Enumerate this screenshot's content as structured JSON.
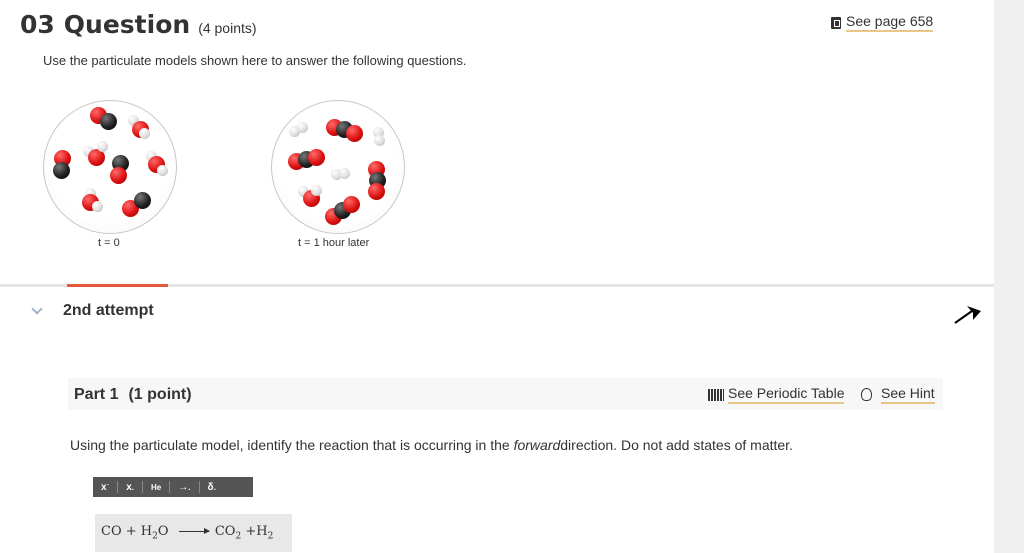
{
  "question": {
    "number": "03",
    "word": "Question",
    "points": "(4 points)",
    "see_page": "See page 658",
    "instructions": "Use the particulate models shown here to answer the following questions."
  },
  "models": {
    "left_caption": "t = 0",
    "right_caption": "t = 1 hour later"
  },
  "attempt": {
    "label": "2nd attempt"
  },
  "part": {
    "title": "Part 1",
    "points": "(1 point)",
    "periodic_table_label": "See Periodic Table",
    "hint_label": "See Hint"
  },
  "prompt": {
    "before": "Using the particulate model, identify the reaction that is occurring in the ",
    "emph": "forward",
    "after": "direction. Do not add states of matter."
  },
  "toolbar": {
    "superscript": "x",
    "subscript": "x",
    "element": "He",
    "arrow": "→",
    "delta": "δ"
  },
  "answer": {
    "lhs_1": "CO",
    "plus_1": "+",
    "lhs_2": "H",
    "lhs_2_sub": "2",
    "lhs_2_tail": "O",
    "rhs_1": "CO",
    "rhs_1_sub": "2",
    "plus_2": "+",
    "rhs_2": "H",
    "rhs_2_sub": "2"
  },
  "icons": {
    "book": "book-icon",
    "periodic_table": "periodic-table-icon",
    "hint": "lightbulb-icon",
    "collapse": "chevron-down-icon",
    "cursor": "cursor-icon"
  },
  "colors": {
    "accent": "#e8583a",
    "link_underline": "#e8c68a",
    "toolbar": "#555555"
  }
}
